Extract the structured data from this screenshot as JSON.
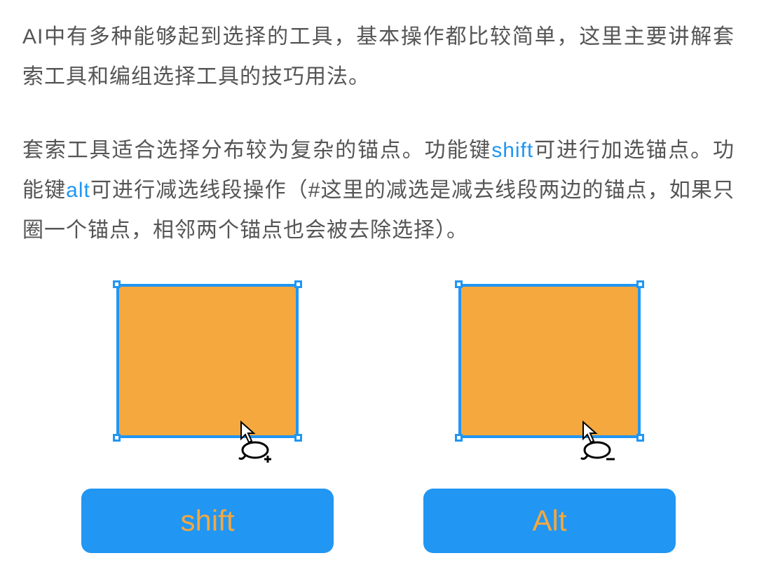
{
  "paragraphs": {
    "p1": "AI中有多种能够起到选择的工具，基本操作都比较简单，这里主要讲解套索工具和编组选择工具的技巧用法。",
    "p2_part1": "套索工具适合选择分布较为复杂的锚点。功能键",
    "p2_shift": "shift",
    "p2_part2": "可进行加选锚点。功能键",
    "p2_alt": "alt",
    "p2_part3": "可进行减选线段操作（#这里的减选是减去线段两边的锚点，如果只圈一个锚点，相邻两个锚点也会被去除选择）。"
  },
  "illustrations": {
    "left": {
      "cursor_type": "lasso-add",
      "key_label": "shift"
    },
    "right": {
      "cursor_type": "lasso-subtract",
      "key_label": "Alt"
    }
  },
  "colors": {
    "accent_blue": "#2196F3",
    "fill_orange": "#F5A83D",
    "text_gray": "#555555"
  }
}
